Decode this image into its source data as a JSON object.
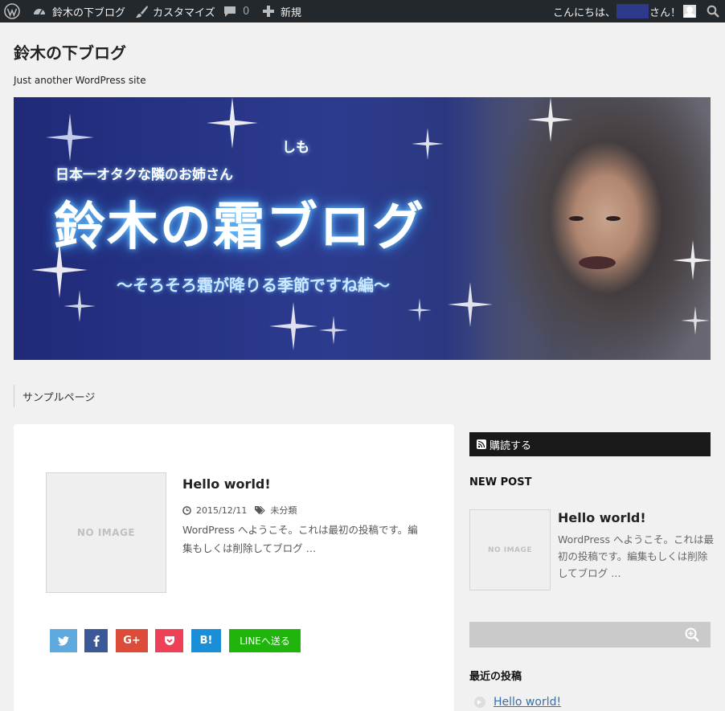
{
  "admin_bar": {
    "site_name": "鈴木の下ブログ",
    "customize": "カスタマイズ",
    "comments_count": "0",
    "new_label": "新規",
    "greeting_prefix": "こんにちは、",
    "greeting_suffix": "さん！"
  },
  "header": {
    "site_title": "鈴木の下ブログ",
    "tagline": "Just another WordPress site"
  },
  "banner": {
    "small_line": "日本一オタクな隣のお姉さん",
    "ruby": "しも",
    "title": "鈴木の霜ブログ",
    "subtitle": "〜そろそろ霜が降りる季節ですね編〜"
  },
  "nav": {
    "items": [
      {
        "label": "サンプルページ"
      }
    ]
  },
  "post": {
    "thumbnail_text": "NO IMAGE",
    "title": "Hello world!",
    "date": "2015/12/11",
    "category": "未分類",
    "excerpt": "WordPress へようこそ。これは最初の投稿です。編集もしくは削除してブログ …"
  },
  "share": {
    "googleplus": "G+",
    "hatena": "B!",
    "line": "LINEへ送る"
  },
  "sidebar": {
    "subscribe_label": "購読する",
    "new_post_heading": "NEW POST",
    "new_post": {
      "thumbnail_text": "NO IMAGE",
      "title": "Hello world!",
      "excerpt": "WordPress へようこそ。これは最初の投稿です。編集もしくは削除してブログ …"
    },
    "recent_heading": "最近の投稿",
    "recent_posts": [
      {
        "title": "Hello world!"
      }
    ]
  },
  "colors": {
    "admin_bar_bg": "#23282d",
    "twitter": "#5ea9dd",
    "facebook": "#3b5998",
    "googleplus": "#dd4b39",
    "pocket": "#ee4056",
    "hatena": "#1b8ed8",
    "line": "#1fb50a"
  }
}
